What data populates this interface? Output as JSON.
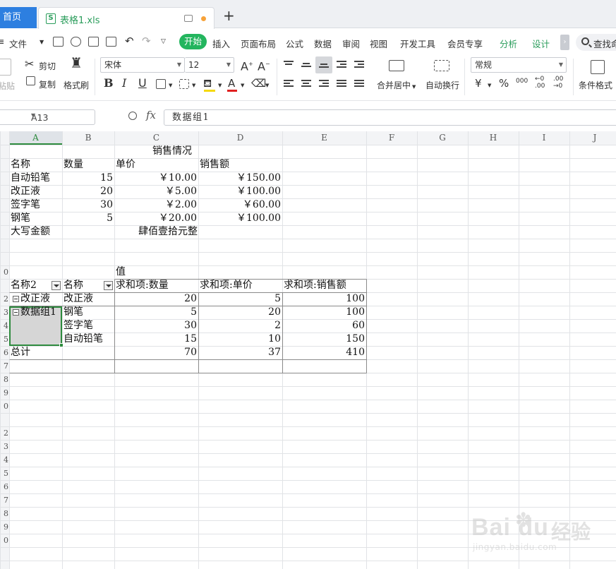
{
  "tabs": {
    "home_label": "首页",
    "file_tab_label": "表格1.xls",
    "new_tab_glyph": "+"
  },
  "menu": {
    "items": [
      "文件",
      "开始",
      "插入",
      "页面布局",
      "公式",
      "数据",
      "审阅",
      "视图",
      "开发工具",
      "会员专享",
      "分析",
      "设计"
    ],
    "search_label": "查找命"
  },
  "ribbon": {
    "paste_label": "粘贴",
    "cut_label": "剪切",
    "copy_label": "复制",
    "format_painter_label": "格式刷",
    "font_name": "宋体",
    "font_size": "12",
    "merge_center_label": "合并居中",
    "wrap_text_label": "自动换行",
    "number_format": "常规",
    "conditional_format_label": "条件格式",
    "currency_glyph": "¥",
    "percent_glyph": "%",
    "thousands_glyph": "000"
  },
  "formula_bar": {
    "cell_ref": "A13",
    "fx_label": "fx",
    "value": "数据组1"
  },
  "columns": [
    "A",
    "B",
    "C",
    "D",
    "E",
    "F",
    "G",
    "H",
    "I",
    "J"
  ],
  "rows": [
    "",
    "",
    "",
    "",
    "",
    "",
    "",
    "",
    "",
    "0",
    "",
    "2",
    "3",
    "4",
    "5",
    "6",
    "7",
    "8",
    "9",
    "0",
    "",
    "2",
    "3",
    "4",
    "5",
    "6",
    "7",
    "8",
    "9",
    "0",
    ""
  ],
  "sheet": {
    "title": "销售情况",
    "headers": [
      "名称",
      "数量",
      "单价",
      "销售额"
    ],
    "items": [
      {
        "name": "自动铅笔",
        "qty": "15",
        "price": "￥10.00",
        "amount": "￥150.00"
      },
      {
        "name": "改正液",
        "qty": "20",
        "price": "￥5.00",
        "amount": "￥100.00"
      },
      {
        "name": "签字笔",
        "qty": "30",
        "price": "￥2.00",
        "amount": "￥60.00"
      },
      {
        "name": "钢笔",
        "qty": "5",
        "price": "￥20.00",
        "amount": "￥100.00"
      }
    ],
    "capital_label": "大写金额",
    "capital_value": "肆佰壹拾元整"
  },
  "pivot": {
    "values_label": "值",
    "row_field_1": "名称2",
    "row_field_2": "名称",
    "headers": [
      "求和项:数量",
      "求和项:单价",
      "求和项:销售额"
    ],
    "rows": [
      {
        "group": "改正液",
        "name": "改正液",
        "qty": "20",
        "price": "5",
        "amount": "100"
      },
      {
        "group": "数据组1",
        "name": "钢笔",
        "qty": "5",
        "price": "20",
        "amount": "100"
      },
      {
        "group": "",
        "name": "签字笔",
        "qty": "30",
        "price": "2",
        "amount": "60"
      },
      {
        "group": "",
        "name": "自动铅笔",
        "qty": "15",
        "price": "10",
        "amount": "150"
      }
    ],
    "total_label": "总计",
    "total_qty": "70",
    "total_price": "37",
    "total_amount": "410"
  },
  "watermark": {
    "brand": "Bai du",
    "brand_cn": "经验",
    "url": "jingyan.baidu.com"
  }
}
